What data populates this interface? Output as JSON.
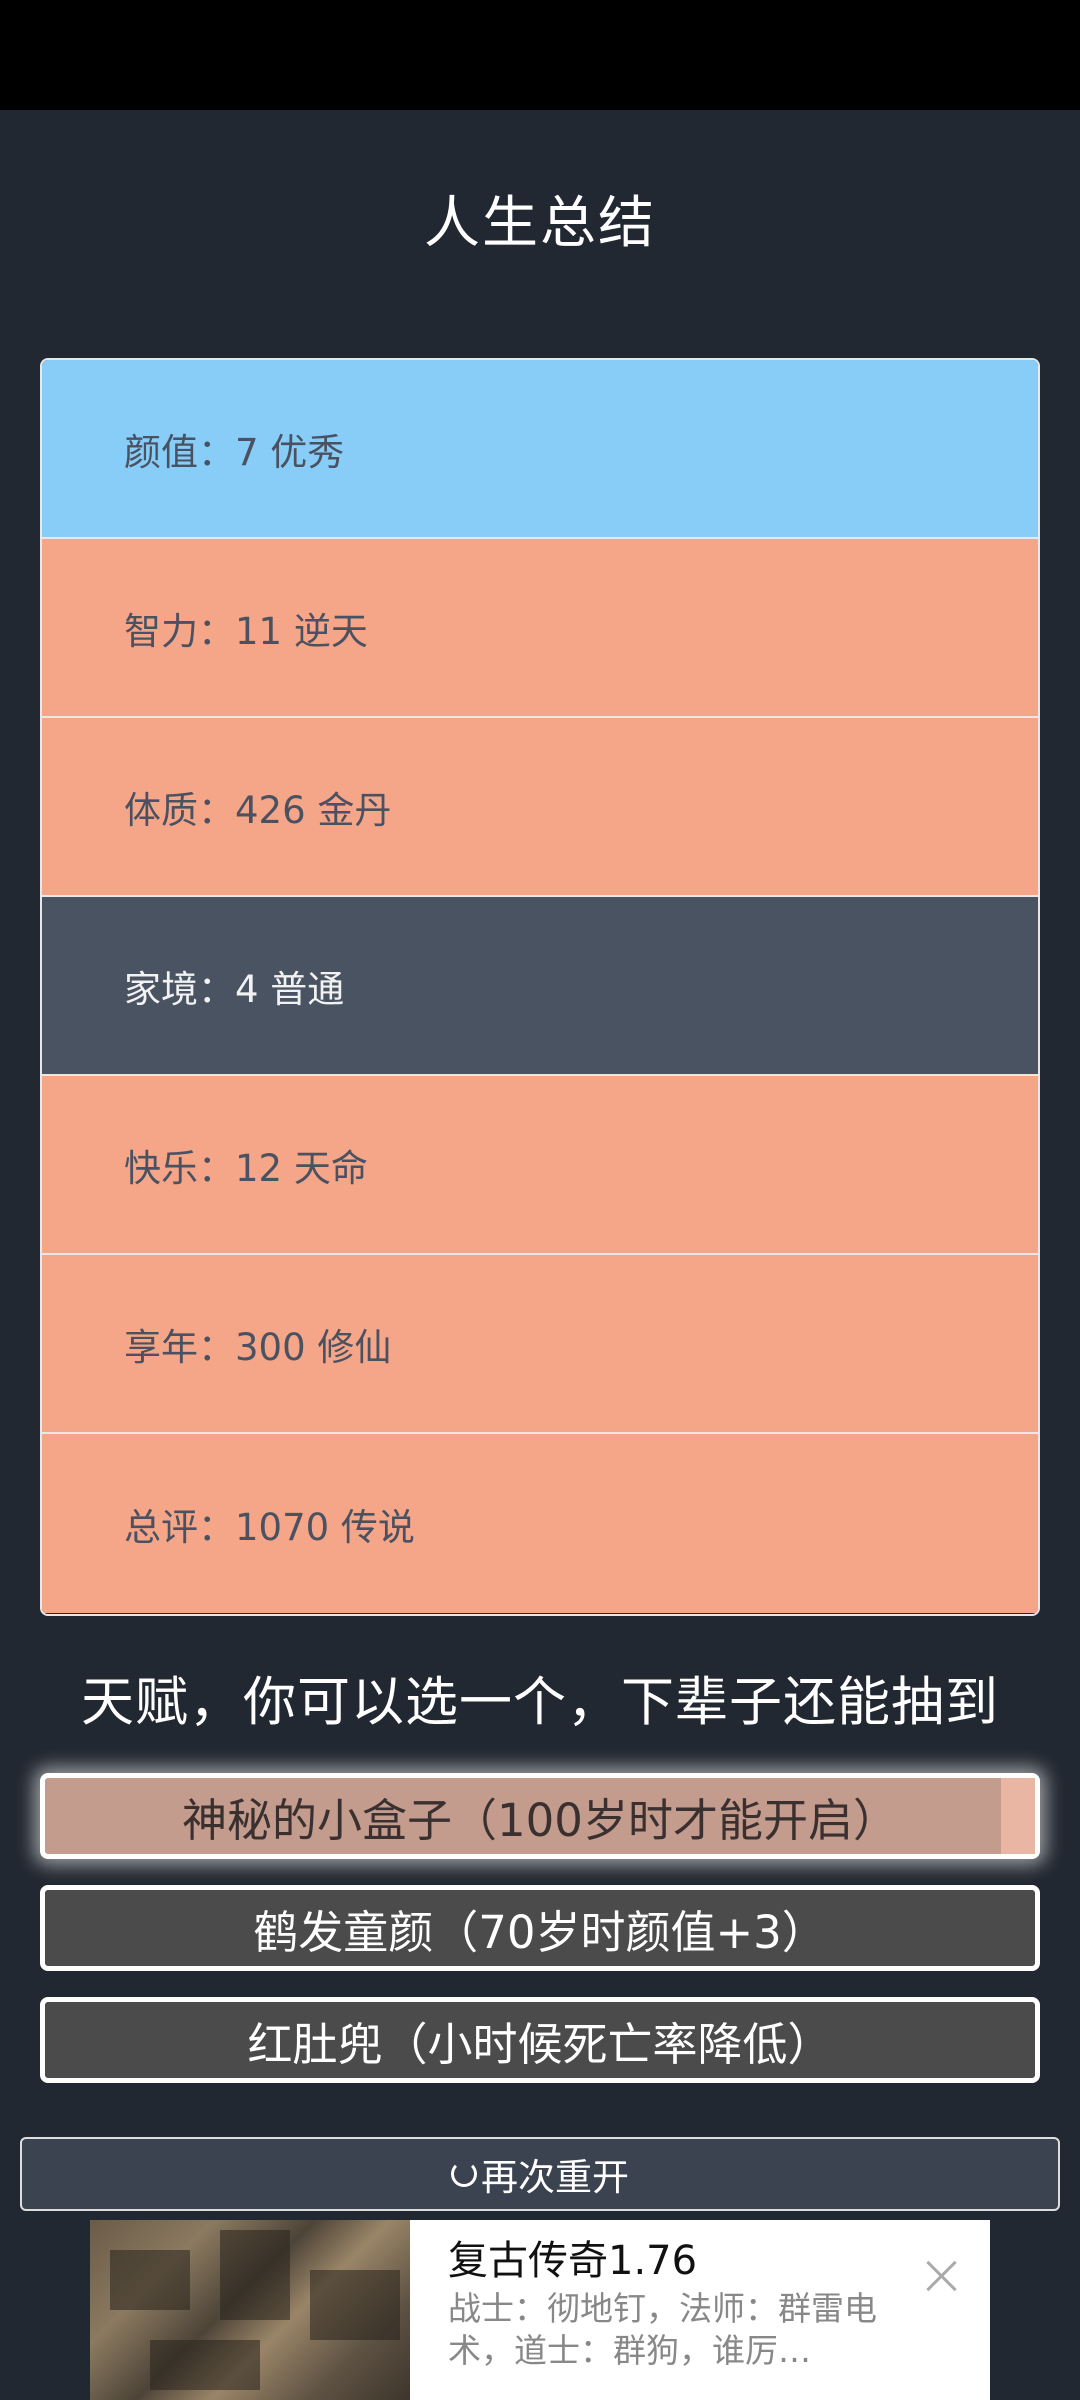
{
  "page": {
    "title": "人生总结"
  },
  "stats": [
    {
      "text": "颜值：7 优秀",
      "color": "#87cdf8"
    },
    {
      "text": "智力：11 逆天",
      "color": "#f6a688"
    },
    {
      "text": "体质：426 金丹",
      "color": "#f6a688"
    },
    {
      "text": "家境：4 普通",
      "color": "#495362"
    },
    {
      "text": "快乐：12 天命",
      "color": "#f6a688"
    },
    {
      "text": "享年：300 修仙",
      "color": "#f6a688"
    },
    {
      "text": "总评：1070 传说",
      "color": "#f6a688"
    }
  ],
  "talents": {
    "heading": "天赋，你可以选一个，下辈子还能抽到",
    "options": [
      {
        "label": "神秘的小盒子（100岁时才能开启）",
        "selected": true
      },
      {
        "label": "鹤发童颜（70岁时颜值+3）",
        "selected": false
      },
      {
        "label": "红肚兜（小时候死亡率降低）",
        "selected": false
      }
    ]
  },
  "restart": {
    "label": "再次重开",
    "icon": "refresh-icon"
  },
  "ad": {
    "title": "复古传奇1.76",
    "description": "战士：彻地钉，法师：群雷电术，道士：群狗，谁厉…",
    "close_icon": "close-icon"
  }
}
